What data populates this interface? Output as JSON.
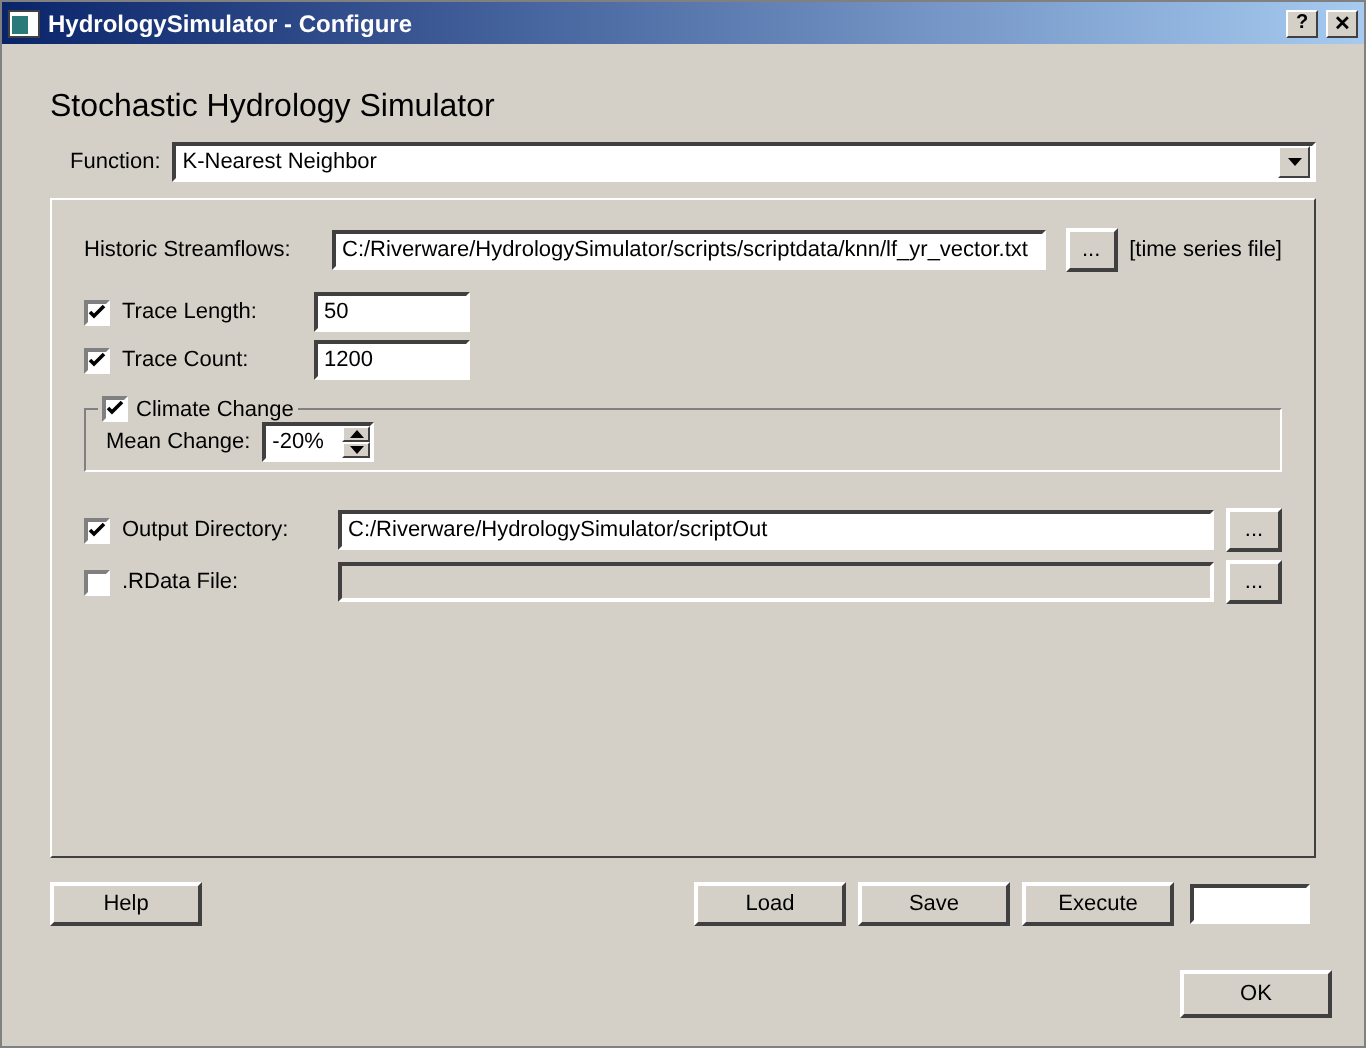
{
  "window": {
    "title": "HydrologySimulator - Configure",
    "title_buttons": [
      "?",
      "✕"
    ]
  },
  "heading": "Stochastic Hydrology Simulator",
  "function": {
    "label": "Function:",
    "value": "K-Nearest Neighbor"
  },
  "streamflows": {
    "label": "Historic Streamflows:",
    "value": "C:/Riverware/HydrologySimulator/scripts/scriptdata/knn/lf_yr_vector.txt",
    "browse": "...",
    "hint": "[time series file]"
  },
  "trace_fields": [
    {
      "label": "Trace Length:",
      "checked": true,
      "value": "50"
    },
    {
      "label": "Trace Count:",
      "checked": true,
      "value": "1200"
    }
  ],
  "climate": {
    "label": "Climate Change",
    "checked": true,
    "mean_label": "Mean Change:",
    "mean_value": "-20%"
  },
  "paths": [
    {
      "label": "Output Directory:",
      "checked": true,
      "value": "C:/Riverware/HydrologySimulator/scriptOut",
      "browse": "..."
    },
    {
      "label": ".RData File:",
      "checked": false,
      "browse": "..."
    }
  ],
  "buttons_left": [
    "Help"
  ],
  "buttons_right": [
    "Load",
    "Save",
    "Execute"
  ],
  "ok": "OK"
}
